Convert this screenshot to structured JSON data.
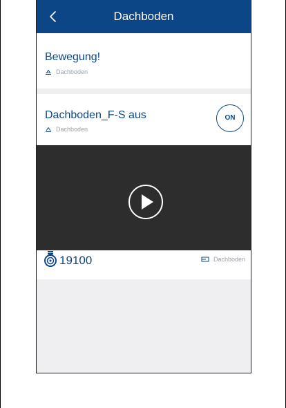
{
  "header": {
    "title": "Dachboden"
  },
  "cards": [
    {
      "title": "Bewegung!",
      "room": "Dachboden"
    },
    {
      "title": "Dachboden_F-S aus",
      "room": "Dachboden",
      "toggle_label": "ON"
    }
  ],
  "counter": {
    "value": "19100",
    "room": "Dachboden"
  },
  "colors": {
    "header_bg": "#0d4687",
    "accent": "#0d4687",
    "video_bg": "#2d2d2d",
    "page_bg": "#efeff2",
    "muted_text": "#9aa2ab"
  },
  "icons": {
    "back": "chevron-left-icon",
    "room": "room-icon",
    "play": "play-icon",
    "counter": "meter-icon",
    "room_tag": "room-floor-icon"
  }
}
